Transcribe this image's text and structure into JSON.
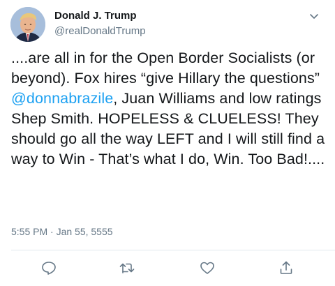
{
  "user": {
    "display_name": "Donald J. Trump",
    "handle": "@realDonaldTrump"
  },
  "tweet": {
    "text_before": "....are all in for the Open Border Socialists (or beyond). Fox hires “give Hillary the questions” ",
    "mention": "@donnabrazile",
    "text_after": ", Juan Williams and low ratings Shep Smith. HOPELESS & CLUELESS! They should go all the way LEFT and I will still find a way to Win - That’s what I do, Win. Too Bad!....",
    "timestamp": "5:55 PM · Jan 55, 5555"
  },
  "icons": {
    "more": "chevron-down-icon",
    "reply": "reply-icon",
    "retweet": "retweet-icon",
    "like": "heart-icon",
    "share": "share-icon"
  },
  "colors": {
    "text": "#14171a",
    "secondary": "#657786",
    "link": "#1da1f2",
    "divider": "#e1e8ed"
  }
}
